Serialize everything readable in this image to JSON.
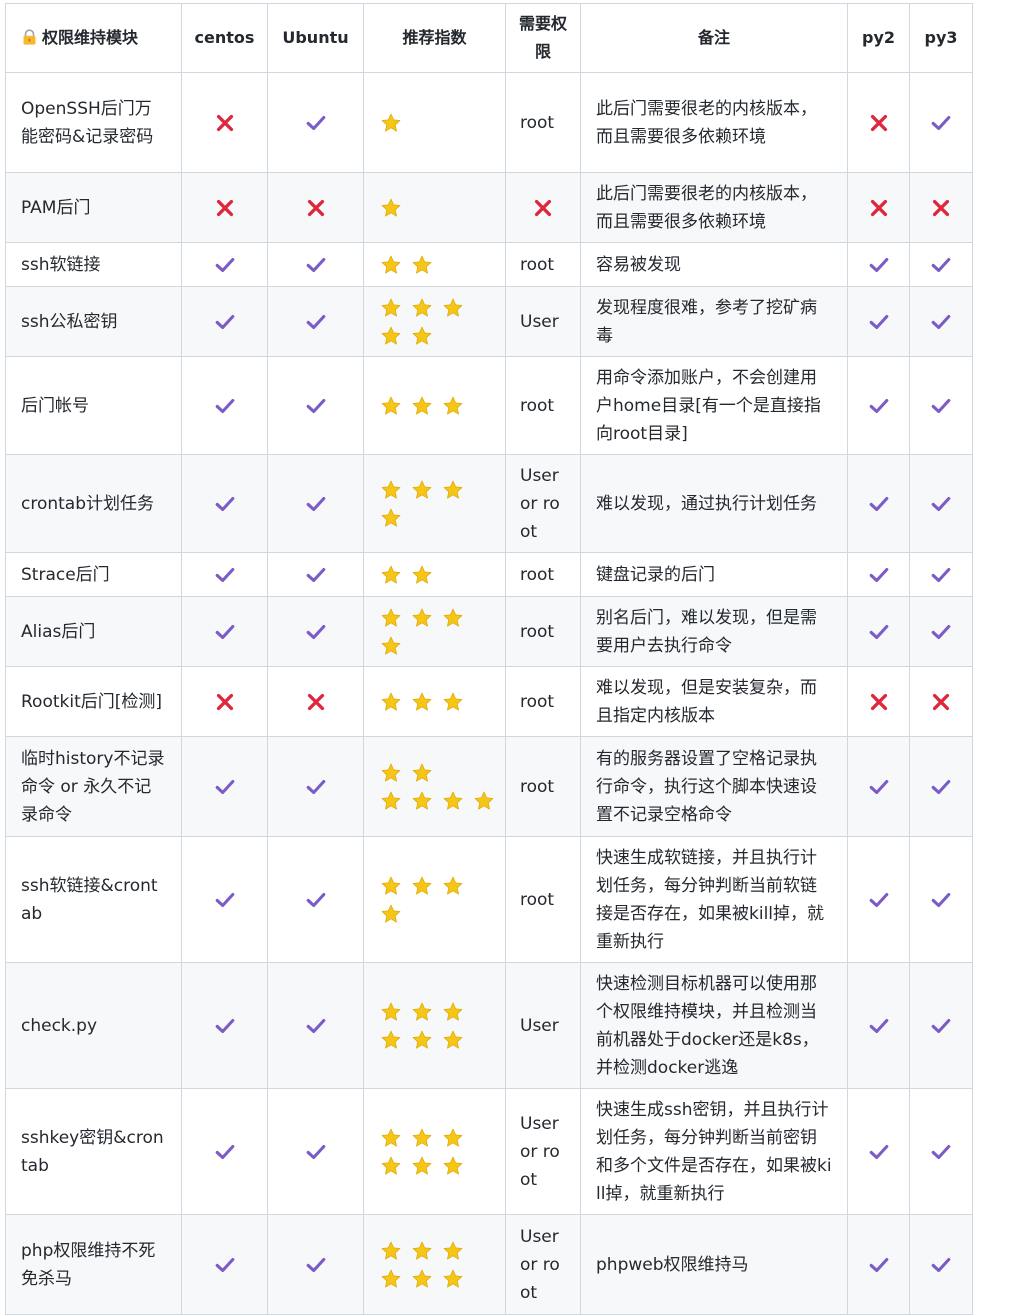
{
  "headers": [
    "权限维持模块",
    "centos",
    "Ubuntu",
    "推荐指数",
    "需要权限",
    "备注",
    "py2",
    "py3"
  ],
  "header_icon": "lock-icon",
  "colors": {
    "check": "#7b5cc7",
    "cross": "#e0263b",
    "star": "#f5c518",
    "border": "#d0d7de",
    "stripe": "#f6f8fa"
  },
  "rows": [
    {
      "module": "OpenSSH后门万能密码&记录密码",
      "centos": "no",
      "ubuntu": "ok",
      "stars": [
        1
      ],
      "perm": "root",
      "note": "此后门需要很老的内核版本，而且需要很多依赖环境",
      "py2": "no",
      "py3": "ok"
    },
    {
      "module": "PAM后门",
      "centos": "no",
      "ubuntu": "no",
      "stars": [
        1
      ],
      "perm": "",
      "perm_mark": "no",
      "note": "此后门需要很老的内核版本，而且需要很多依赖环境",
      "py2": "no",
      "py3": "no"
    },
    {
      "module": "ssh软链接",
      "centos": "ok",
      "ubuntu": "ok",
      "stars": [
        2
      ],
      "perm": "root",
      "note": "容易被发现",
      "py2": "ok",
      "py3": "ok"
    },
    {
      "module": "ssh公私密钥",
      "centos": "ok",
      "ubuntu": "ok",
      "stars": [
        3,
        2
      ],
      "perm": "User",
      "note": "发现程度很难，参考了挖矿病毒",
      "py2": "ok",
      "py3": "ok"
    },
    {
      "module": "后门帐号",
      "centos": "ok",
      "ubuntu": "ok",
      "stars": [
        3
      ],
      "perm": "root",
      "note": "用命令添加账户，不会创建用户home目录[有一个是直接指向root目录]",
      "py2": "ok",
      "py3": "ok"
    },
    {
      "module": "crontab计划任务",
      "centos": "ok",
      "ubuntu": "ok",
      "stars": [
        3,
        1
      ],
      "perm": "User or root",
      "note": "难以发现，通过执行计划任务",
      "py2": "ok",
      "py3": "ok"
    },
    {
      "module": "Strace后门",
      "centos": "ok",
      "ubuntu": "ok",
      "stars": [
        2
      ],
      "perm": "root",
      "note": "键盘记录的后门",
      "py2": "ok",
      "py3": "ok"
    },
    {
      "module": "Alias后门",
      "centos": "ok",
      "ubuntu": "ok",
      "stars": [
        3,
        1
      ],
      "perm": "root",
      "note": "别名后门，难以发现，但是需要用户去执行命令",
      "py2": "ok",
      "py3": "ok"
    },
    {
      "module": "Rootkit后门[检测]",
      "centos": "no",
      "ubuntu": "no",
      "stars": [
        3
      ],
      "perm": "root",
      "note": "难以发现，但是安装复杂，而且指定内核版本",
      "py2": "no",
      "py3": "no"
    },
    {
      "module": "临时history不记录命令 or 永久不记录命令",
      "centos": "ok",
      "ubuntu": "ok",
      "stars": [
        2,
        4
      ],
      "perm": "root",
      "note": "有的服务器设置了空格记录执行命令，执行这个脚本快速设置不记录空格命令",
      "py2": "ok",
      "py3": "ok"
    },
    {
      "module": "ssh软链接&crontab",
      "centos": "ok",
      "ubuntu": "ok",
      "stars": [
        3,
        1
      ],
      "perm": "root",
      "note": "快速生成软链接，并且执行计划任务，每分钟判断当前软链接是否存在，如果被kill掉，就重新执行",
      "py2": "ok",
      "py3": "ok"
    },
    {
      "module": "check.py",
      "centos": "ok",
      "ubuntu": "ok",
      "stars": [
        3,
        3
      ],
      "perm": "User",
      "note": "快速检测目标机器可以使用那个权限维持模块，并且检测当前机器处于docker还是k8s，并检测docker逃逸",
      "py2": "ok",
      "py3": "ok"
    },
    {
      "module": "sshkey密钥&crontab",
      "centos": "ok",
      "ubuntu": "ok",
      "stars": [
        3,
        3
      ],
      "perm": "User or root",
      "note": "快速生成ssh密钥，并且执行计划任务，每分钟判断当前密钥和多个文件是否存在，如果被kill掉，就重新执行",
      "py2": "ok",
      "py3": "ok"
    },
    {
      "module": "php权限维持不死免杀马",
      "centos": "ok",
      "ubuntu": "ok",
      "stars": [
        3,
        3
      ],
      "perm": "User or root",
      "note": "phpweb权限维持马",
      "py2": "ok",
      "py3": "ok"
    }
  ]
}
